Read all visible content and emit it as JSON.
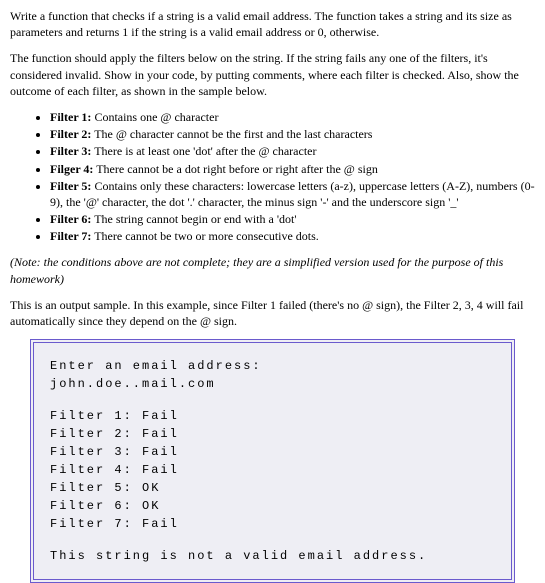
{
  "intro1": "Write a function that checks if a string is a valid email address. The function takes a string and its size as parameters and returns 1 if the string is a valid email address or 0, otherwise.",
  "intro2": "The function should apply the filters below on the string. If the string fails any one of the filters, it's considered invalid. Show in your code, by putting comments, where each filter is checked. Also, show the outcome of each filter, as shown in the sample below.",
  "filters": [
    {
      "label": "Filter 1:",
      "desc": " Contains one @ character"
    },
    {
      "label": "Filter 2:",
      "desc": " The @ character cannot be the first and the last characters"
    },
    {
      "label": "Filter 3:",
      "desc": " There is at least one 'dot' after the @ character"
    },
    {
      "label": "Filger 4:",
      "desc": " There cannot be a dot right before or right after the @ sign"
    },
    {
      "label": "Filter 5:",
      "desc": " Contains only these characters: lowercase letters (a-z), uppercase letters (A-Z), numbers (0-9), the '@' character, the dot '.' character, the minus sign '-' and the underscore sign '_'"
    },
    {
      "label": "Filter 6:",
      "desc": " The string cannot begin or end with a 'dot'"
    },
    {
      "label": "Filter 7:",
      "desc": " There cannot be two or more consecutive dots."
    }
  ],
  "note": "(Note: the conditions above are not complete; they are a simplified version used for the purpose of this homework)",
  "sample_intro": "This is an output sample. In this example, since Filter 1 failed (there's no @ sign), the Filter 2, 3, 4 will fail automatically since they depend on the @ sign.",
  "sample": {
    "prompt": "Enter an email address:",
    "input": "john.doe..mail.com",
    "results": [
      "Filter 1: Fail",
      "Filter 2: Fail",
      "Filter 3: Fail",
      "Filter 4: Fail",
      "Filter 5: OK",
      "Filter 6: OK",
      "Filter 7: Fail"
    ],
    "conclusion": "This string is not a valid email address."
  }
}
